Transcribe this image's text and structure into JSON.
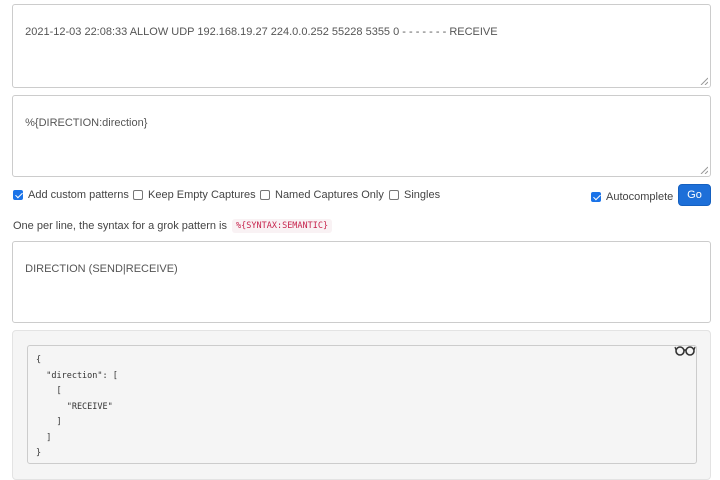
{
  "input": {
    "sample": "2021-12-03 22:08:33 ALLOW UDP 192.168.19.27 224.0.0.252 55228 5355 0 - - - - - - - RECEIVE",
    "pattern": "%{DIRECTION:direction}"
  },
  "options": {
    "add_custom_patterns": {
      "label": "Add custom patterns",
      "checked": true
    },
    "keep_empty_captures": {
      "label": "Keep Empty Captures",
      "checked": false
    },
    "named_captures_only": {
      "label": "Named Captures Only",
      "checked": false
    },
    "singles": {
      "label": "Singles",
      "checked": false
    },
    "autocomplete": {
      "label": "Autocomplete",
      "checked": true
    },
    "go_label": "Go"
  },
  "custom_patterns": {
    "help_text": "One per line, the syntax for a grok pattern is",
    "syntax_example": "%{SYNTAX:SEMANTIC}",
    "value": "DIRECTION (SEND|RECEIVE)"
  },
  "output": {
    "json_text": "{\n  \"direction\": [\n    [\n      \"RECEIVE\"\n    ]\n  ]\n}"
  },
  "icons": {
    "toggle_view": "glasses-icon",
    "resize": "resize-grip-icon",
    "checkbox_color": "#1a73e8",
    "button_color": "#1d6fd8"
  }
}
